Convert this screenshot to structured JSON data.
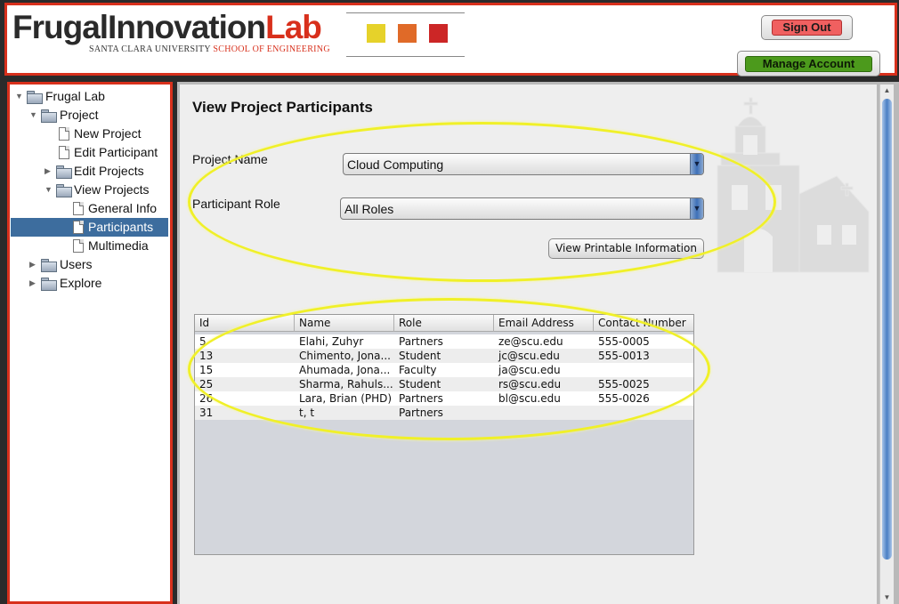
{
  "header": {
    "logo_main": "FrugalInnovation",
    "logo_lab": "Lab",
    "logo_sub_school": "SANTA CLARA UNIVERSITY",
    "logo_sub_eng": "SCHOOL OF ENGINEERING",
    "sign_out_label": "Sign Out",
    "manage_account_label": "Manage Account",
    "colors": {
      "brand_red": "#d8301c",
      "square_yellow": "#e6d22a",
      "square_orange": "#e06a28",
      "square_red": "#cc2626",
      "signout": "#f06060",
      "manage": "#4c9a1c"
    }
  },
  "sidebar": {
    "items": [
      {
        "label": "Frugal Lab",
        "icon": "folder-icon",
        "expanded": true
      },
      {
        "label": "Project",
        "icon": "folder-icon",
        "expanded": true
      },
      {
        "label": "New Project",
        "icon": "document-icon"
      },
      {
        "label": "Edit Participant",
        "icon": "document-icon"
      },
      {
        "label": "Edit Projects",
        "icon": "folder-icon",
        "expanded": false
      },
      {
        "label": "View Projects",
        "icon": "folder-icon",
        "expanded": true
      },
      {
        "label": "General Info",
        "icon": "document-icon"
      },
      {
        "label": "Participants",
        "icon": "document-icon",
        "selected": true
      },
      {
        "label": "Multimedia",
        "icon": "document-icon"
      },
      {
        "label": "Users",
        "icon": "folder-icon",
        "expanded": false
      },
      {
        "label": "Explore",
        "icon": "folder-icon",
        "expanded": false
      }
    ],
    "selected_color": "#3d6d9e"
  },
  "main": {
    "title": "View Project Participants",
    "project_name_label": "Project Name",
    "project_name_value": "Cloud Computing",
    "participant_role_label": "Participant Role",
    "participant_role_value": "All Roles",
    "print_button_label": "View Printable Information",
    "table": {
      "columns": [
        "Id",
        "Name",
        "Role",
        "Email Address",
        "Contact Number"
      ],
      "rows": [
        [
          "5",
          "Elahi, Zuhyr",
          "Partners",
          "ze@scu.edu",
          "555-0005"
        ],
        [
          "13",
          "Chimento, Jona...",
          "Student",
          "jc@scu.edu",
          "555-0013"
        ],
        [
          "15",
          "Ahumada, Jona...",
          "Faculty",
          "ja@scu.edu",
          ""
        ],
        [
          "25",
          "Sharma, Rahuls...",
          "Student",
          "rs@scu.edu",
          "555-0025"
        ],
        [
          "26",
          "Lara, Brian (PHD)",
          "Partners",
          "bl@scu.edu",
          "555-0026"
        ],
        [
          "31",
          "t, t",
          "Partners",
          "",
          ""
        ]
      ]
    },
    "highlight_color": "#f0f028"
  }
}
